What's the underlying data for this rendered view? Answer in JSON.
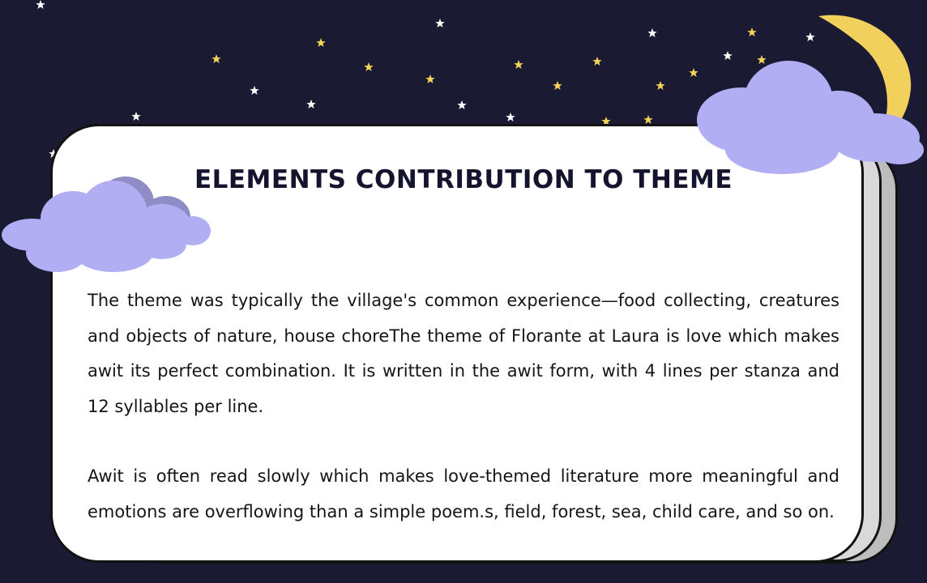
{
  "slide": {
    "title": "ELEMENTS CONTRIBUTION TO THEME",
    "paragraphs": [
      "The theme was typically the village's common experience—food collecting, creatures and objects of nature, house choreThe theme of Florante at Laura is love which makes awit its perfect combination. It is written in the awit form, with 4 lines per stanza and 12 syllables per line.",
      "Awit is often read slowly which makes love-themed literature more meaningful and emotions are overflowing than a simple poem.s, field, forest, sea, child care, and so on."
    ]
  },
  "decorations": {
    "moon_icon": "crescent-moon-icon",
    "cloud_icon": "cloud-icon",
    "star_icon": "star-icon"
  },
  "colors": {
    "background": "#1b1a33",
    "cloud": "#b1aef4",
    "moon": "#f1d15c",
    "star_yellow": "#f3d457",
    "star_white": "#ffffff"
  }
}
